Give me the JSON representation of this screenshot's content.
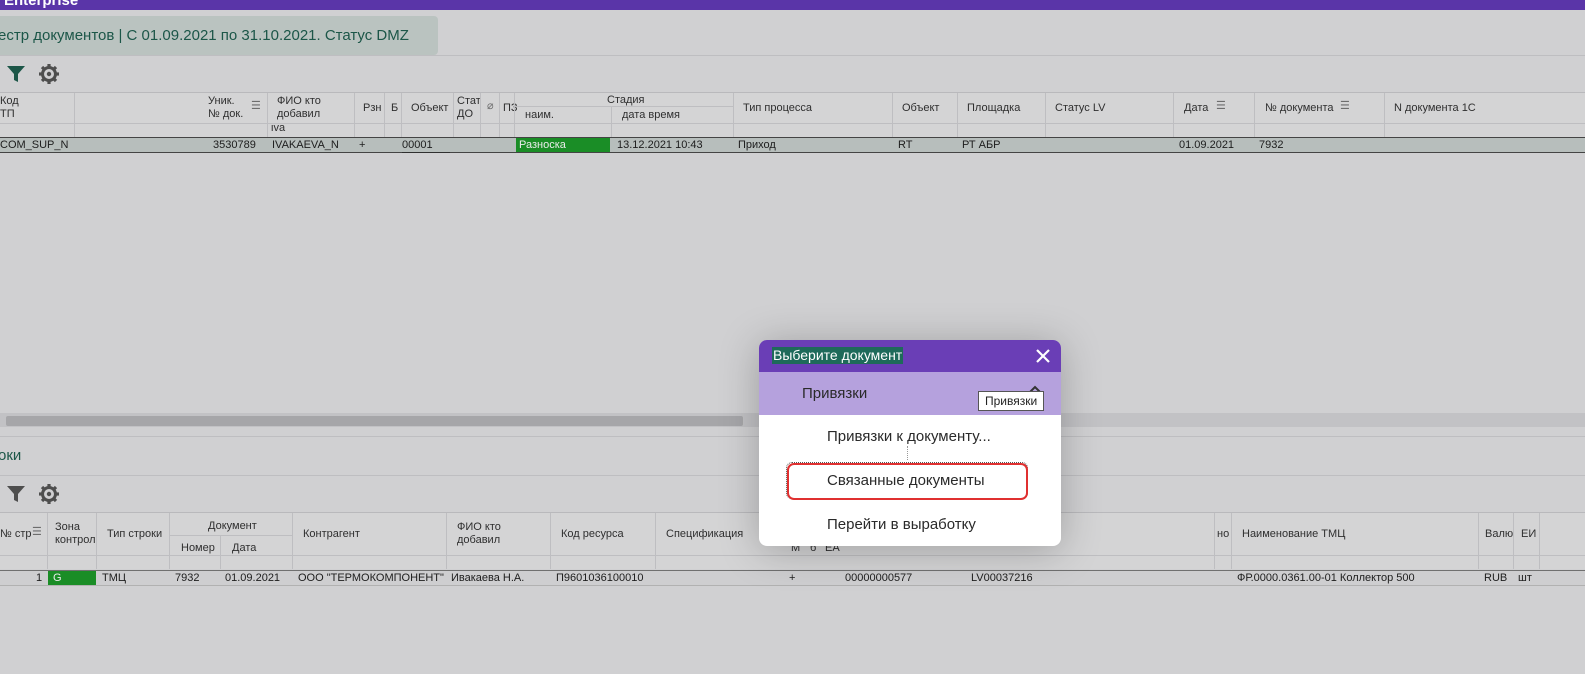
{
  "app": {
    "title": "Enterprise",
    "chevrons": "»"
  },
  "page_tab": {
    "label": "естр документов | С 01.09.2021 по 31.10.2021. Статус DMZ"
  },
  "toolbar": {
    "filter_icon": "filter-icon",
    "settings_icon": "gear-icon"
  },
  "grid1": {
    "headers": {
      "kod": "Код",
      "tp": "ТП",
      "unik1": "Уник.",
      "unik2": "№ док.",
      "fio1": "ФИО кто",
      "fio2": "добавил",
      "fio_filter": "iva",
      "rzn": "Рзн",
      "b": "Б",
      "obj": "Объект",
      "stat1": "Стат",
      "stat2": "ДО",
      "pz": "ПЗ",
      "stage": "Стадия",
      "stage_name": "наим.",
      "stage_dt": "дата время",
      "proc": "Тип процесса",
      "obj2": "Объект",
      "site": "Площадка",
      "lv": "Статус LV",
      "date": "Дата",
      "docno": "№ документа",
      "doc1c": "N документа 1С"
    },
    "row": {
      "kod": "COM_SUP_N",
      "unik": "3530789",
      "fio": "IVAKAEVA_N",
      "rzn": "+",
      "obj": "00001",
      "stage_name": "Разноска",
      "stage_dt": "13.12.2021 10:43",
      "proc": "Приход",
      "obj2": "RT",
      "site": "РТ АБР",
      "date": "01.09.2021",
      "docno": "7932"
    }
  },
  "section2": {
    "title": "оки"
  },
  "grid2": {
    "headers": {
      "nstr": "№ стр",
      "zone1": "Зона",
      "zone2": "контрол",
      "type": "Тип строки",
      "doc": "Документ",
      "doc_num": "Номер",
      "doc_date": "Дата",
      "contr": "Контрагент",
      "fio1": "ФИО кто",
      "fio2": "добавил",
      "res": "Код ресурса",
      "spec": "Спецификация",
      "m": "М",
      "o": "б",
      "ea": "ЕА",
      "nom": "но",
      "name": "Наименование ТМЦ",
      "cur": "Валю",
      "unit": "ЕИ"
    },
    "row": {
      "nstr": "1",
      "zone": "G",
      "type": "ТМЦ",
      "doc_num": "7932",
      "doc_date": "01.09.2021",
      "contr": "ООО \"ТЕРМОКОМПОНЕНТ\"",
      "fio": "Ивакаева Н.А.",
      "res": "П9601036100010",
      "plus": "+",
      "code": "00000000577",
      "lv": "LV00037216",
      "name": "ФР.0000.0361.00-01 Коллектор 500",
      "cur": "RUB",
      "unit": "шт"
    }
  },
  "dialog": {
    "title": "Выберите документ",
    "group": "Привязки",
    "items": [
      "Привязки к документу...",
      "Связанные документы",
      "Перейти в выработку"
    ],
    "tooltip": "Привязки"
  },
  "colors": {
    "header_purple": "#6a3eb6",
    "group_lilac": "#b5a1dd",
    "stage_green": "#1d9a2a",
    "highlight_red": "#e03030"
  }
}
